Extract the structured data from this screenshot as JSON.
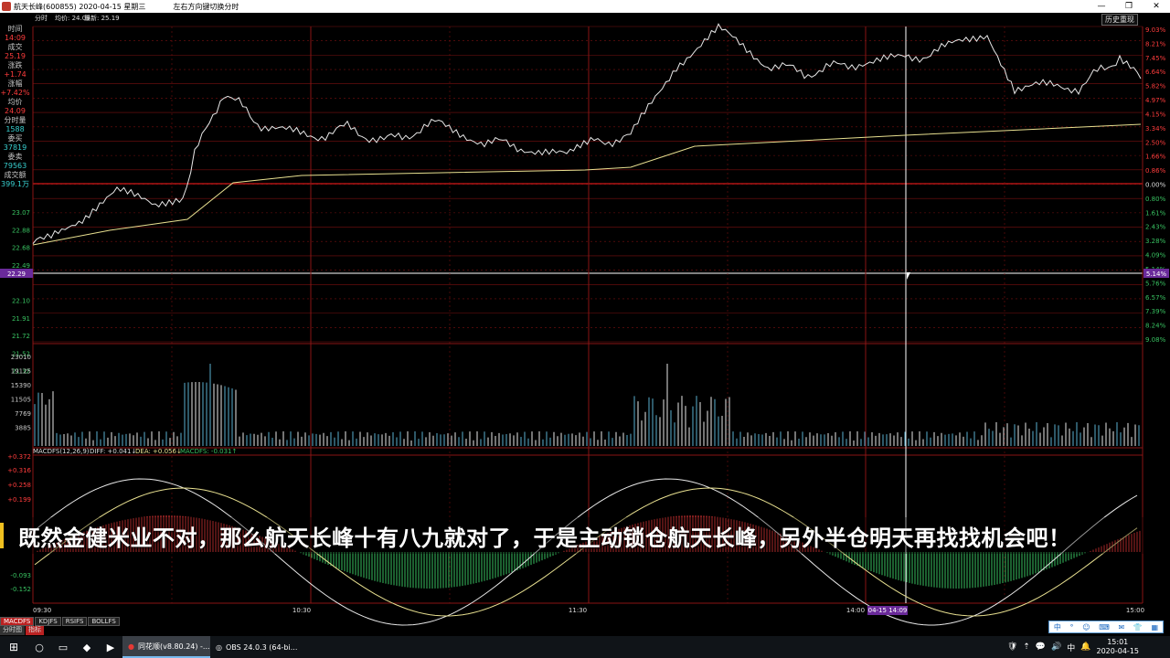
{
  "window": {
    "title": "航天长峰(600855) 2020-04-15 星期三",
    "hint": "左右方向键切换分时",
    "controls": [
      "—",
      "❐",
      "✕"
    ]
  },
  "header": {
    "mode": "分时",
    "avg_label": "均价: 24.09",
    "last_label": "最新: 25.19",
    "history_button": "历史重现"
  },
  "info_panel": [
    {
      "label": "时间",
      "value": "14:09"
    },
    {
      "label": "成交",
      "value": "25.19"
    },
    {
      "label": "涨跌",
      "value": "+1.74"
    },
    {
      "label": "涨幅",
      "value": "+7.42%"
    },
    {
      "label": "均价",
      "value": "24.09"
    },
    {
      "label": "分时量",
      "value": "1588"
    },
    {
      "label": "委买",
      "value": "37819"
    },
    {
      "label": "委卖",
      "value": "79563"
    },
    {
      "label": "成交额",
      "value": "399.1万"
    }
  ],
  "price_axis_left": [
    "23.07",
    "22.88",
    "22.68",
    "22.49",
    "22.29",
    "22.10",
    "21.91",
    "21.72",
    "21.52",
    "21.32"
  ],
  "pct_axis_right": [
    "9.03%",
    "8.21%",
    "7.45%",
    "6.64%",
    "5.82%",
    "4.97%",
    "4.15%",
    "3.34%",
    "2.50%",
    "1.66%",
    "0.86%",
    "0.00%",
    "0.80%",
    "1.61%",
    "2.43%",
    "3.28%",
    "4.09%",
    "5.14%",
    "5.76%",
    "6.57%",
    "7.39%",
    "8.24%",
    "9.08%"
  ],
  "crosshair_left": "22.29",
  "crosshair_right": "5.14%",
  "volume_axis": [
    "23010",
    "19125",
    "15390",
    "11505",
    "7769",
    "3885"
  ],
  "macd": {
    "label": "MACDFS(12,26,9)",
    "diff": "DIFF: +0.041↓",
    "dea": "DEA: +0.056↓",
    "macdfs": "MACDFS: -0.031↑",
    "axis": [
      "+0.372",
      "+0.316",
      "+0.258",
      "+0.199",
      "-0.093",
      "-0.152"
    ]
  },
  "time_axis": [
    "09:30",
    "10:30",
    "11:30",
    "14:00",
    "15:00"
  ],
  "time_cursor": "04-15 14:09",
  "indicator_tabs": [
    "MACDFS",
    "KDJFS",
    "RSIFS",
    "BOLLFS"
  ],
  "bottom_tabs": [
    "分时图",
    "指标"
  ],
  "subtitle": "既然金健米业不对，那么航天长峰十有八九就对了，于是主动锁仓航天长峰，另外半仓明天再找找机会吧！",
  "taskbar": {
    "start": "⊞",
    "apps": [
      {
        "label": "同花顺(v8.80.24) -...",
        "active": true
      },
      {
        "label": "OBS 24.0.3 (64-bi...",
        "active": false
      }
    ],
    "tray": [
      "🛡",
      "⇡",
      "💬",
      "🔊",
      "中",
      "🔔"
    ],
    "time": "15:01",
    "date": "2020-04-15"
  },
  "ime_bar": [
    "中",
    "°",
    "☺",
    "⌨",
    "✉",
    "👕",
    "▦"
  ],
  "colors": {
    "price_line": "#e8e8e8",
    "avg_line": "#e8e090",
    "grid_red": "#7a1010",
    "base_red": "#d01818",
    "up": "#ff3c3c",
    "down": "#38c060",
    "crosshair_row": "#6a2a9a"
  }
}
